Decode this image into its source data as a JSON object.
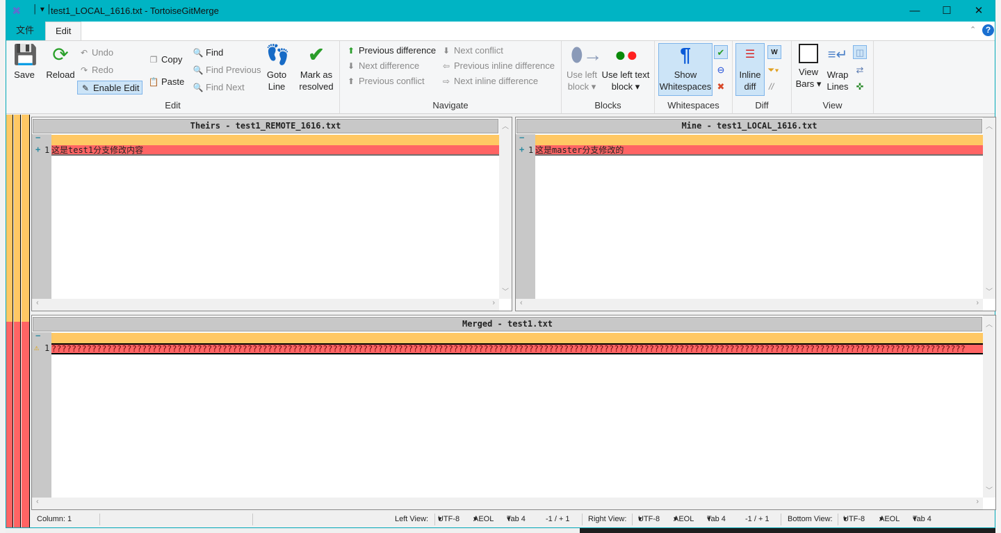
{
  "window": {
    "title": "test1_LOCAL_1616.txt - TortoiseGitMerge",
    "minimize": "—",
    "maximize": "☐",
    "close": "✕"
  },
  "menu": {
    "tabs": [
      "文件",
      "Edit"
    ],
    "help": "?"
  },
  "ribbon": {
    "edit_group": {
      "label": "Edit",
      "save": "Save",
      "reload": "Reload",
      "undo": "Undo",
      "redo": "Redo",
      "enable_edit": "Enable Edit",
      "copy": "Copy",
      "paste": "Paste",
      "find": "Find",
      "find_previous": "Find Previous",
      "find_next": "Find Next",
      "goto_line": [
        "Goto",
        "Line"
      ],
      "mark_resolved": [
        "Mark as",
        "resolved"
      ]
    },
    "navigate_group": {
      "label": "Navigate",
      "previous_difference": "Previous difference",
      "next_difference": "Next difference",
      "previous_conflict": "Previous conflict",
      "next_conflict": "Next conflict",
      "previous_inline_difference": "Previous inline difference",
      "next_inline_difference": "Next inline difference"
    },
    "blocks_group": {
      "label": "Blocks",
      "use_left_block": [
        "Use left",
        "block"
      ],
      "use_left_text_block": [
        "Use left text",
        "block"
      ]
    },
    "whitespaces_group": {
      "label": "Whitespaces",
      "show_whitespaces": [
        "Show",
        "Whitespaces"
      ]
    },
    "diff_group": {
      "label": "Diff",
      "inline_diff": [
        "Inline",
        "diff"
      ]
    },
    "view_group": {
      "label": "View",
      "view_bars": [
        "View",
        "Bars"
      ],
      "wrap_lines": [
        "Wrap",
        "Lines"
      ]
    }
  },
  "panes": {
    "theirs": {
      "title": "Theirs - test1_REMOTE_1616.txt",
      "line_no": "1",
      "text": "这是test1分支修改内容"
    },
    "mine": {
      "title": "Mine - test1_LOCAL_1616.txt",
      "line_no": "1",
      "text": "这是master分支修改的"
    },
    "merged": {
      "title": "Merged - test1.txt",
      "line_no": "1",
      "text": "??????????????????????????????????????????????????????????????????????????????????????????????????????????????????????????????????????????????????????????????????????????????????????"
    }
  },
  "status": {
    "column": "Column: 1",
    "left_view": "Left View:",
    "right_view": "Right View:",
    "bottom_view": "Bottom View:",
    "encoding": "UTF-8",
    "eol": "AEOL",
    "tab": "Tab 4",
    "changes": "-1 / + 1"
  },
  "colors": {
    "titlebar": "#00b4c4",
    "conflict": "#ff6464",
    "changed": "#ffc864"
  }
}
